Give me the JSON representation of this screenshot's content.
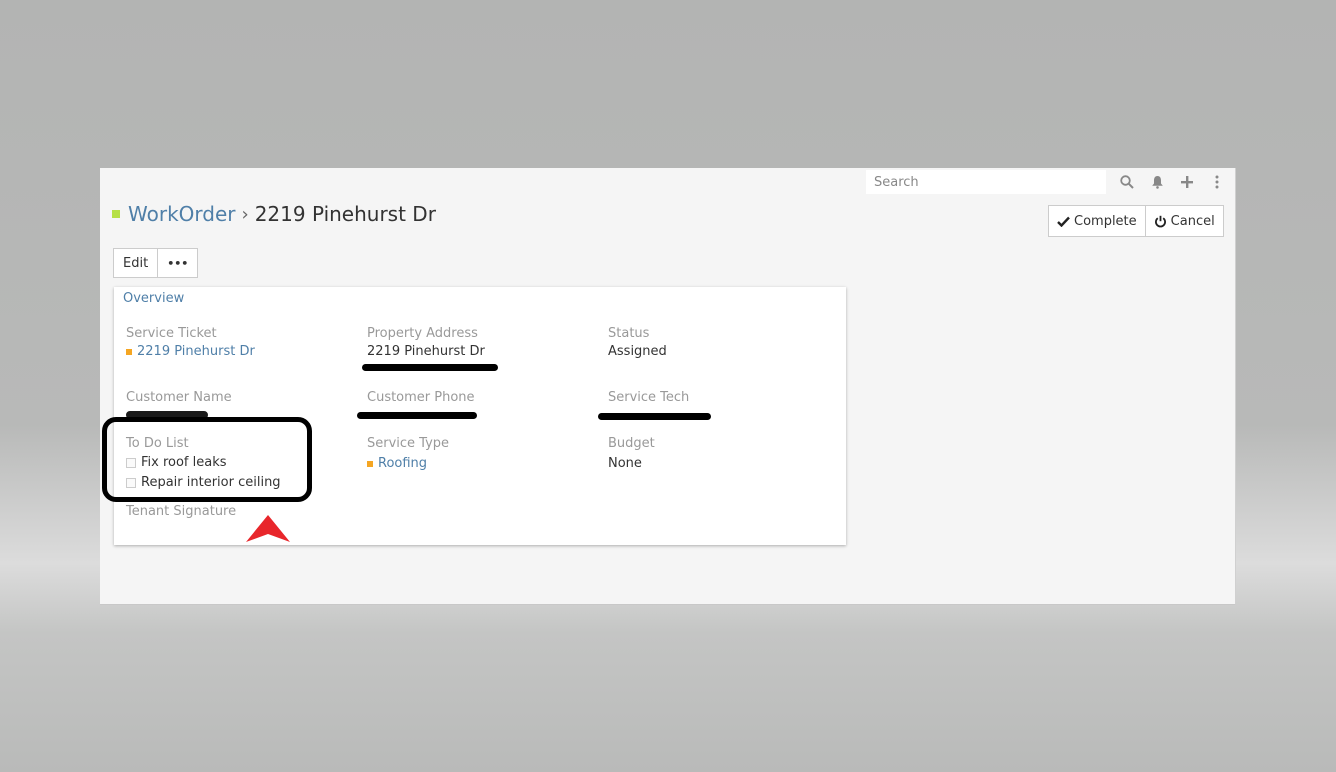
{
  "search": {
    "placeholder": "Search"
  },
  "icons": {
    "search": "search-icon",
    "bell": "bell-icon",
    "add": "plus-icon",
    "more": "vertical-dots-icon"
  },
  "breadcrumb": {
    "parent": "WorkOrder",
    "separator": "›",
    "current": "2219 Pinehurst Dr"
  },
  "actions": {
    "complete": "Complete",
    "cancel": "Cancel"
  },
  "toolbar": {
    "edit": "Edit",
    "more": "•••"
  },
  "overview": {
    "title": "Overview",
    "service_ticket": {
      "label": "Service Ticket",
      "value": "2219 Pinehurst Dr"
    },
    "property_address": {
      "label": "Property Address",
      "value": "2219 Pinehurst Dr"
    },
    "status": {
      "label": "Status",
      "value": "Assigned"
    },
    "customer_name": {
      "label": "Customer Name"
    },
    "customer_phone": {
      "label": "Customer Phone"
    },
    "service_tech": {
      "label": "Service Tech"
    },
    "todo": {
      "label": "To Do List",
      "items": [
        "Fix roof leaks",
        "Repair interior ceiling"
      ]
    },
    "service_type": {
      "label": "Service Type",
      "value": "Roofing"
    },
    "budget": {
      "label": "Budget",
      "value": "None"
    },
    "tenant_signature": {
      "label": "Tenant Signature"
    }
  },
  "colors": {
    "accent_link": "#4f7fa8",
    "title_marker": "#b6e046",
    "ticket_marker": "#f5a623",
    "annotation_arrow": "#e8262b"
  }
}
